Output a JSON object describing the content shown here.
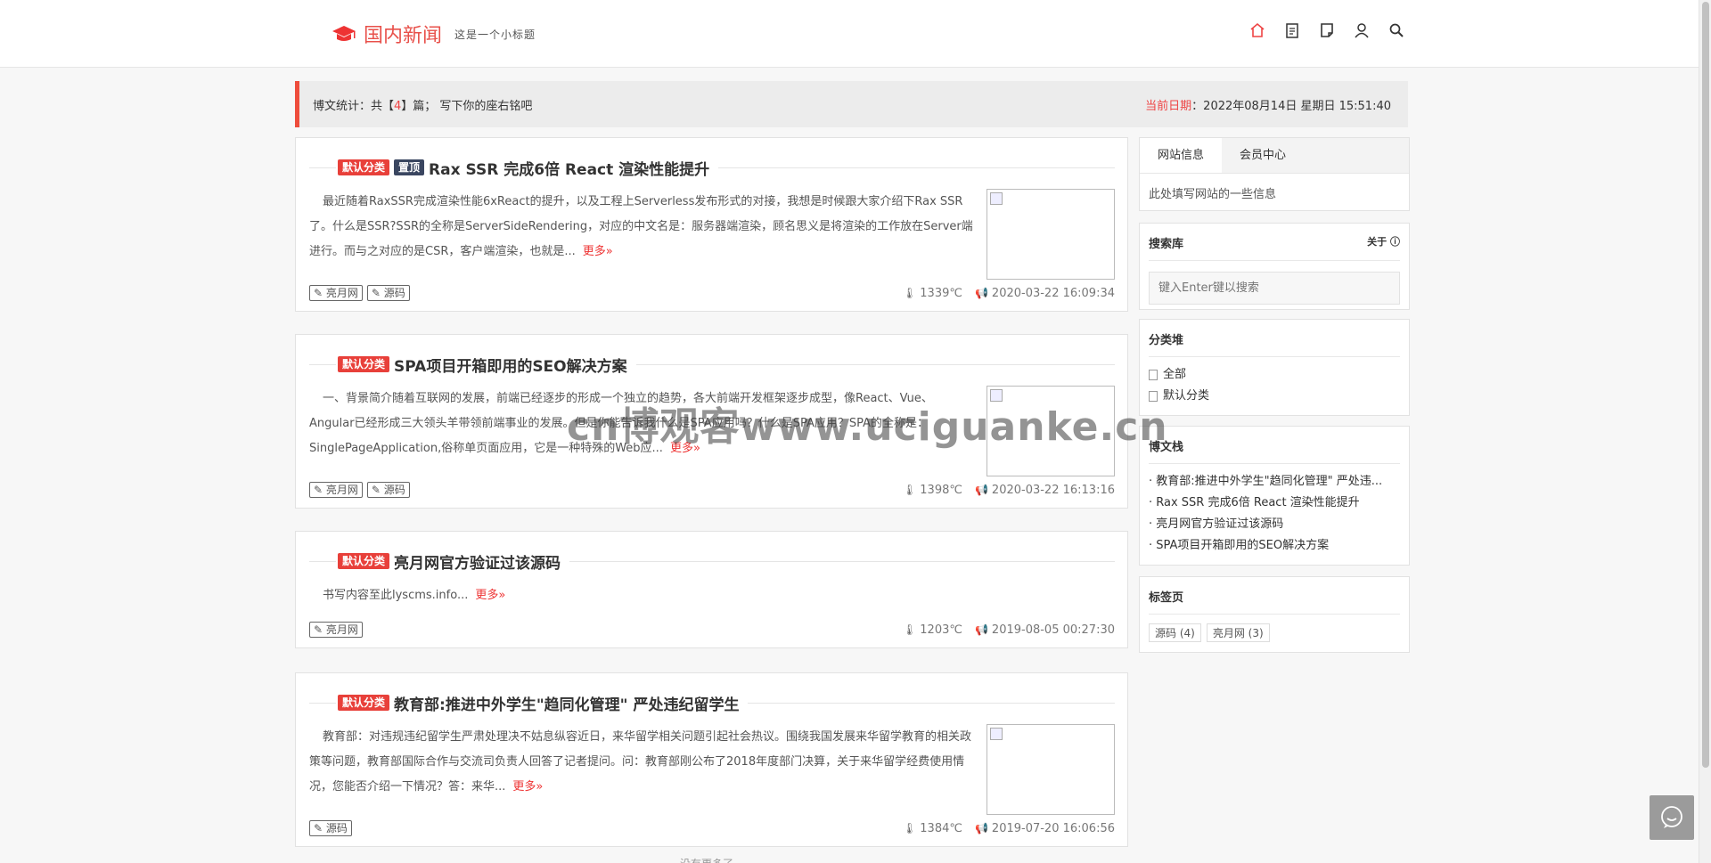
{
  "header": {
    "title": "国内新闻",
    "subtitle": "这是一个小标题",
    "icons": [
      "home-icon",
      "clipboard-icon",
      "note-icon",
      "user-icon",
      "search-icon"
    ]
  },
  "statbar": {
    "stats_prefix": "博文统计：共【",
    "stats_count": "4",
    "stats_suffix": "】篇；  写下你的座右铭吧",
    "date_label": "当前日期",
    "date_value": "：2022年08月14日 星期日 15:51:40"
  },
  "posts": [
    {
      "badges": [
        "默认分类",
        "置顶"
      ],
      "title": "Rax SSR 完成6倍 React 渲染性能提升",
      "excerpt": "最近随着RaxSSR完成渲染性能6xReact的提升，以及工程上Serverless发布形式的对接，我想是时候跟大家介绍下Rax SSR了。什么是SSR?SSR的全称是ServerSideRendering，对应的中文名是：服务器端渲染，顾名思义是将渲染的工作放在Server端进行。而与之对应的是CSR，客户端渲染，也就是...",
      "more": "更多»",
      "tags": [
        "亮月网",
        "源码"
      ],
      "views": "1339℃",
      "date": "2020-03-22 16:09:34"
    },
    {
      "badges": [
        "默认分类"
      ],
      "title": "SPA项目开箱即用的SEO解决方案",
      "excerpt": "一、背景简介随着互联网的发展，前端已经逐步的形成一个独立的趋势，各大前端开发框架逐步成型，像React、Vue、Angular已经形成三大领头羊带领前端事业的发展。但是你能告诉我什么是SPA应用吗？什么是SPA应用？SPA的全称是：SinglePageApplication,俗称单页面应用，它是一种特殊的Web应...",
      "more": "更多»",
      "tags": [
        "亮月网",
        "源码"
      ],
      "views": "1398℃",
      "date": "2020-03-22 16:13:16"
    },
    {
      "badges": [
        "默认分类"
      ],
      "title": "亮月网官方验证过该源码",
      "excerpt": "书写内容至此lyscms.info...",
      "more": "更多»",
      "tags": [
        "亮月网"
      ],
      "views": "1203℃",
      "date": "2019-08-05 00:27:30"
    },
    {
      "badges": [
        "默认分类"
      ],
      "title": "教育部:推进中外学生\"趋同化管理\" 严处违纪留学生",
      "excerpt": "教育部：对违规违纪留学生严肃处理决不姑息纵容近日，来华留学相关问题引起社会热议。围绕我国发展来华留学教育的相关政策等问题，教育部国际合作与交流司负责人回答了记者提问。问：教育部刚公布了2018年度部门决算，关于来华留学经费使用情况，您能否介绍一下情况？答：来华...",
      "more": "更多»",
      "tags": [
        "源码"
      ],
      "views": "1384℃",
      "date": "2019-07-20 16:06:56"
    }
  ],
  "sidebar": {
    "tabs": [
      "网站信息",
      "会员中心"
    ],
    "info_text": "此处填写网站的一些信息",
    "search_title": "搜索库",
    "search_aux": "关于",
    "search_placeholder": "键入Enter键以搜索",
    "category_title": "分类堆",
    "categories": [
      "全部",
      "默认分类"
    ],
    "recent_title": "博文栈",
    "recent": [
      "教育部:推进中外学生\"趋同化管理\" 严处违...",
      "Rax SSR 完成6倍 React 渲染性能提升",
      "亮月网官方验证过该源码",
      "SPA项目开箱即用的SEO解决方案"
    ],
    "tags_title": "标签页",
    "tag_cloud": [
      "源码 (4)",
      "亮月网 (3)"
    ]
  },
  "watermark": "cn博观客www.uciguanke.cn",
  "footer_note": "没有更多了",
  "colors": {
    "accent": "#e8504a",
    "badge_red": "#e8403a",
    "badge_dark": "#3a4660"
  }
}
